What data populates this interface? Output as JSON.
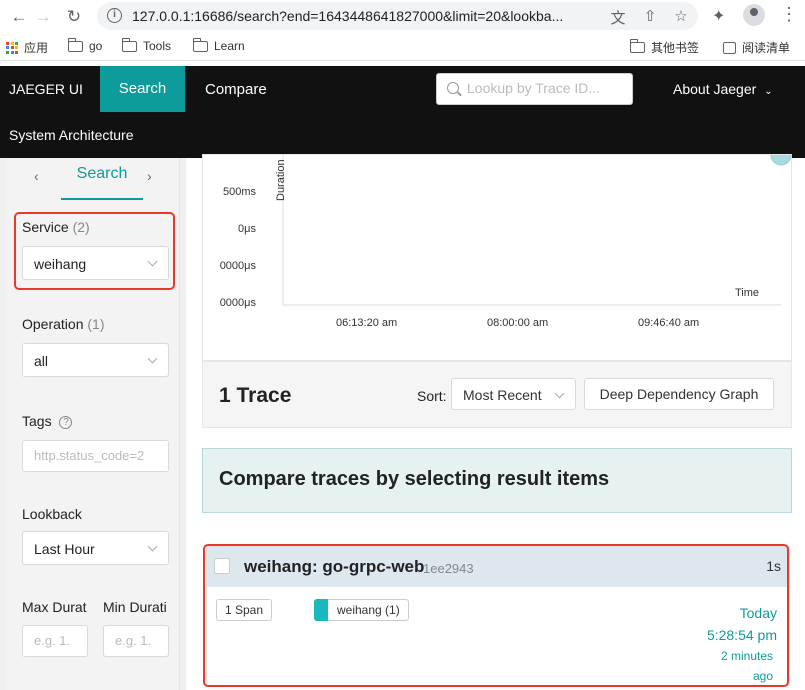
{
  "browser": {
    "url": "127.0.0.1:16686/search?end=1643448641827000&limit=20&lookba...",
    "bookmarks": [
      {
        "label": "应用"
      },
      {
        "label": "go"
      },
      {
        "label": "Tools"
      },
      {
        "label": "Learn"
      }
    ],
    "other_bookmarks": "其他书签",
    "reading_list": "阅读清单"
  },
  "topnav": {
    "brand": "JAEGER UI",
    "tab_search": "Search",
    "tab_compare": "Compare",
    "lookup_placeholder": "Lookup by Trace ID...",
    "about": "About Jaeger",
    "system_architecture": "System Architecture"
  },
  "sidebar": {
    "tab_label": "Search",
    "service_label": "Service",
    "service_count": "(2)",
    "service_value": "weihang",
    "operation_label": "Operation",
    "operation_count": "(1)",
    "operation_value": "all",
    "tags_label": "Tags",
    "tags_placeholder": "http.status_code=2",
    "lookback_label": "Lookback",
    "lookback_value": "Last Hour",
    "max_duration_label": "Max Durat",
    "min_duration_label": "Min Durati",
    "max_duration_placeholder": "e.g. 1.",
    "min_duration_placeholder": "e.g. 1."
  },
  "chart_data": {
    "type": "scatter",
    "ylabel": "Duration",
    "xlabel": "Time",
    "y_ticks": [
      "500ms",
      "0μs",
      "0000μs",
      "0000μs"
    ],
    "x_ticks": [
      "06:13:20 am",
      "08:00:00 am",
      "09:46:40 am"
    ]
  },
  "results": {
    "title": "1 Trace",
    "sort_label": "Sort:",
    "sort_value": "Most Recent",
    "ddg_button": "Deep Dependency Graph",
    "compare_text": "Compare traces by selecting result items"
  },
  "trace": {
    "name": "weihang: go-grpc-web",
    "id": "1ee2943",
    "duration": "1s",
    "spans": "1 Span",
    "service_badge": "weihang (1)",
    "service_color": "#17b8be",
    "date": "Today",
    "time": "5:28:54 pm",
    "ago_line1": "2 minutes",
    "ago_line2": "ago"
  },
  "colors": {
    "accent": "#0e9b9b",
    "highlight": "#e8392d",
    "nav_bg": "#111111"
  }
}
